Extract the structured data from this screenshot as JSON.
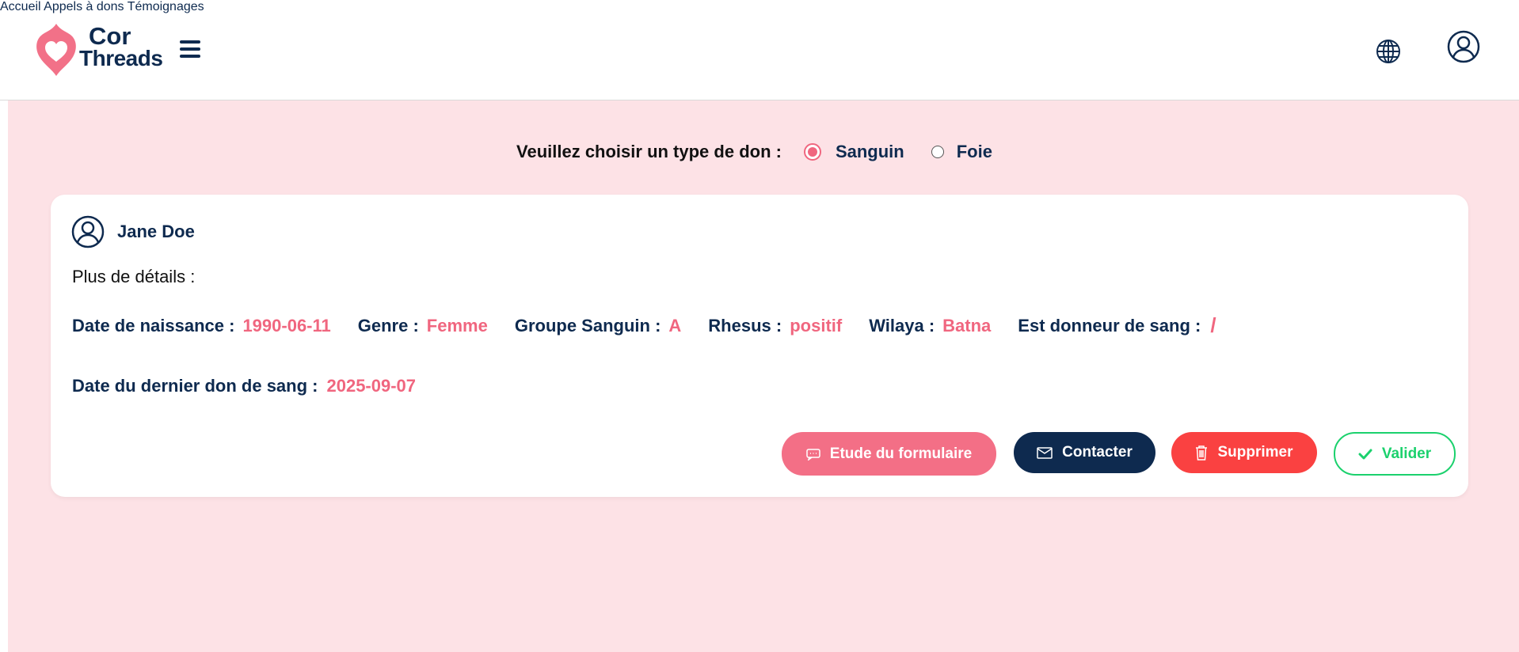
{
  "header": {
    "logo": {
      "line1": "Cor",
      "line2": "Threads"
    },
    "nav": [
      {
        "label": "Accueil"
      },
      {
        "label": "Appels à dons"
      },
      {
        "label": "Témoignages"
      }
    ],
    "icons": [
      "menu-icon",
      "globe-icon",
      "account-icon"
    ]
  },
  "donation_type": {
    "label": "Veuillez choisir un type de don :",
    "options": [
      {
        "label": "Sanguin",
        "selected": true
      },
      {
        "label": "Foie",
        "selected": false
      }
    ]
  },
  "card": {
    "user_name": "Jane Doe",
    "details_title": "Plus de détails :",
    "fields": [
      {
        "label": "Date de naissance :",
        "value": "1990-06-11"
      },
      {
        "label": "Genre :",
        "value": "Femme"
      },
      {
        "label": "Groupe Sanguin :",
        "value": "A"
      },
      {
        "label": "Rhesus :",
        "value": "positif"
      },
      {
        "label": "Wilaya :",
        "value": "Batna"
      },
      {
        "label": "Est donneur de sang :",
        "value": "/"
      }
    ],
    "last_donation": {
      "label": "Date du dernier don de sang :",
      "value": "2025-09-07"
    },
    "buttons": {
      "etude": "Etude du formulaire",
      "contact": "Contacter",
      "delete": "Supprimer",
      "validate": "Valider"
    }
  },
  "colors": {
    "primary_navy": "#0e2a4f",
    "accent_pink": "#f0667f",
    "background_pink": "#fde2e6",
    "danger_red": "#fa4141",
    "success_green": "#1bd16d"
  }
}
